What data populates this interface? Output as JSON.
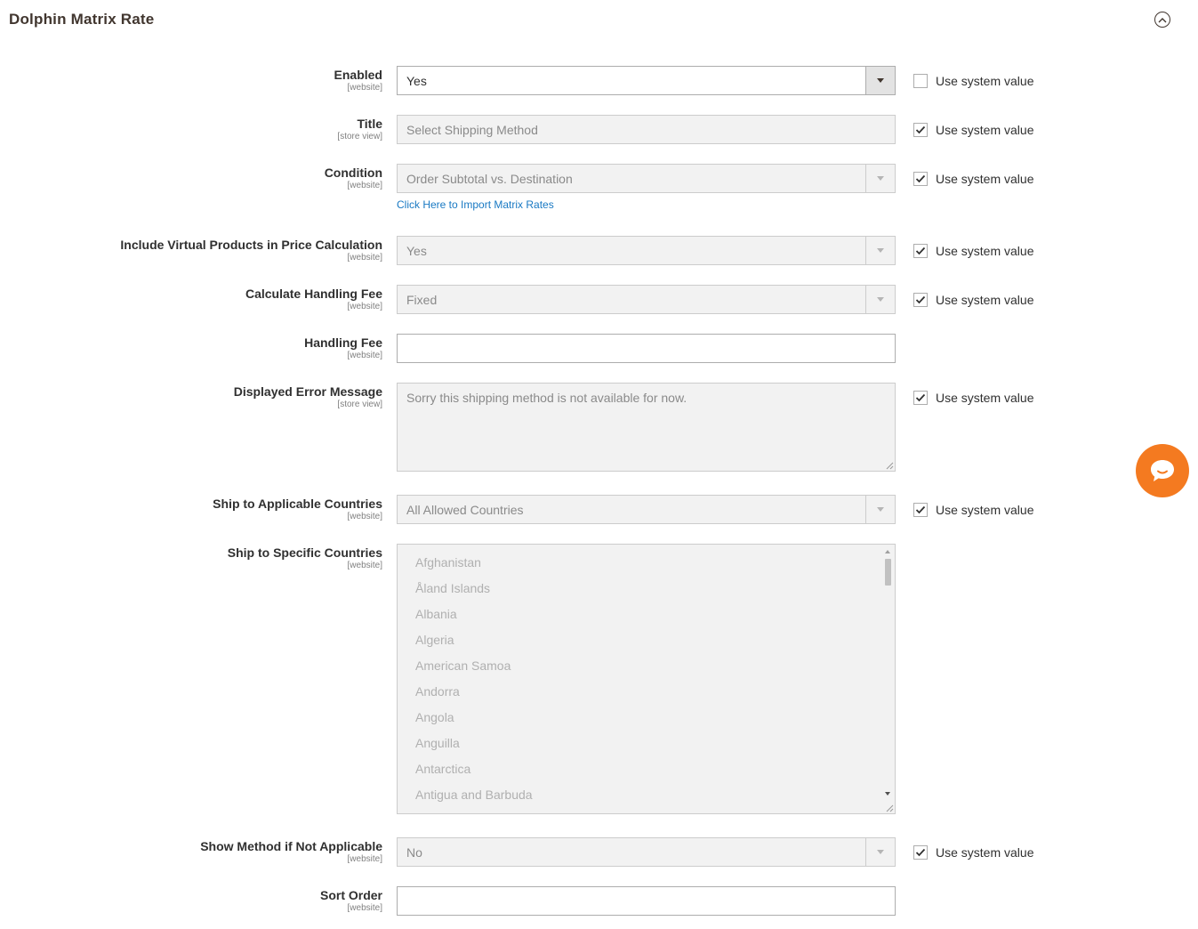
{
  "section": {
    "title": "Dolphin Matrix Rate",
    "collapse_icon": "chevron-up-circle-icon"
  },
  "system_value_label": "Use system value",
  "fields": {
    "enabled": {
      "label": "Enabled",
      "scope": "[website]",
      "value": "Yes",
      "use_system": false
    },
    "title": {
      "label": "Title",
      "scope": "[store view]",
      "value": "Select Shipping Method",
      "use_system": true
    },
    "condition": {
      "label": "Condition",
      "scope": "[website]",
      "value": "Order Subtotal vs. Destination",
      "use_system": true,
      "link": "Click Here to Import Matrix Rates"
    },
    "include_virtual": {
      "label": "Include Virtual Products in Price Calculation",
      "scope": "[website]",
      "value": "Yes",
      "use_system": true
    },
    "calc_handling_fee": {
      "label": "Calculate Handling Fee",
      "scope": "[website]",
      "value": "Fixed",
      "use_system": true
    },
    "handling_fee": {
      "label": "Handling Fee",
      "scope": "[website]",
      "value": ""
    },
    "error_message": {
      "label": "Displayed Error Message",
      "scope": "[store view]",
      "value": "Sorry this shipping method is not available for now.",
      "use_system": true
    },
    "ship_applicable": {
      "label": "Ship to Applicable Countries",
      "scope": "[website]",
      "value": "All Allowed Countries",
      "use_system": true
    },
    "ship_specific": {
      "label": "Ship to Specific Countries",
      "scope": "[website]",
      "options": [
        "Afghanistan",
        "Åland Islands",
        "Albania",
        "Algeria",
        "American Samoa",
        "Andorra",
        "Angola",
        "Anguilla",
        "Antarctica",
        "Antigua and Barbuda"
      ]
    },
    "show_method": {
      "label": "Show Method if Not Applicable",
      "scope": "[website]",
      "value": "No",
      "use_system": true
    },
    "sort_order": {
      "label": "Sort Order",
      "scope": "[website]",
      "value": ""
    }
  },
  "chat": {
    "icon": "chat-bubble-icon",
    "color": "#f47a20"
  },
  "colors": {
    "link": "#1979c3",
    "accent": "#f47a20"
  }
}
